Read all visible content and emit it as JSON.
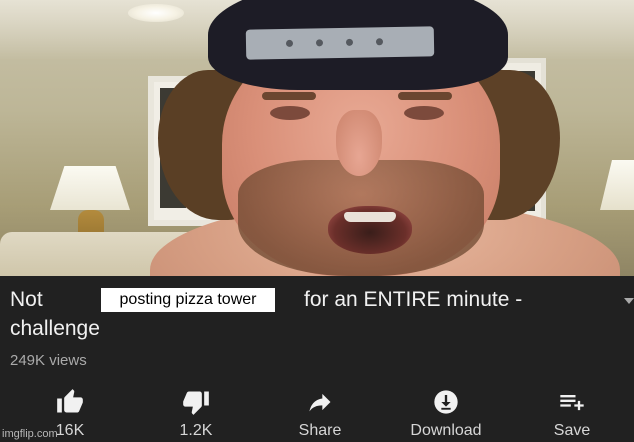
{
  "video": {
    "title_before": "Not",
    "title_inserted": "posting pizza tower",
    "title_after": "for an ENTIRE minute -",
    "title_line2": "challenge",
    "views": "249K views"
  },
  "actions": {
    "like_label": "16K",
    "dislike_label": "1.2K",
    "share_label": "Share",
    "download_label": "Download",
    "save_label": "Save"
  },
  "icons": {
    "like": "thumbs-up-icon",
    "dislike": "thumbs-down-icon",
    "share": "share-arrow-icon",
    "download": "download-icon",
    "save": "playlist-add-icon",
    "expand": "chevron-down-icon"
  },
  "watermark": "imgflip.com",
  "colors": {
    "background": "#212121",
    "title_text": "#f1f1f1",
    "secondary_text": "#aaaaaa",
    "icon": "#f1f1f1",
    "caption_box": "#ffffff"
  }
}
